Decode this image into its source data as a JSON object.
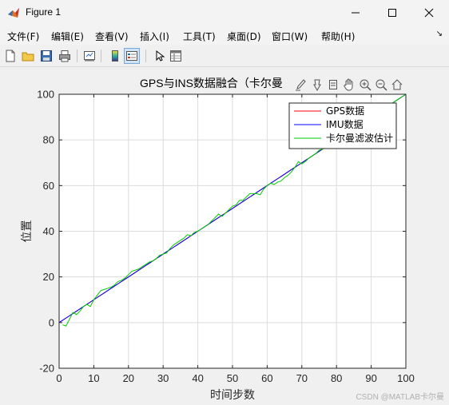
{
  "window": {
    "title": "Figure 1"
  },
  "menu": [
    {
      "label": "文件(F)"
    },
    {
      "label": "编辑(E)"
    },
    {
      "label": "查看(V)"
    },
    {
      "label": "插入(I)"
    },
    {
      "label": "工具(T)"
    },
    {
      "label": "桌面(D)"
    },
    {
      "label": "窗口(W)"
    },
    {
      "label": "帮助(H)"
    }
  ],
  "toolbar_icons": [
    "new-figure-icon",
    "open-file-icon",
    "save-icon",
    "print-icon",
    "link-plot-icon",
    "insert-colorbar-icon",
    "insert-legend-icon",
    "edit-plot-icon",
    "property-inspector-icon"
  ],
  "axes_toolbar_icons": [
    "brush-icon",
    "data-tips-icon",
    "rotate-icon",
    "pan-icon",
    "zoom-in-icon",
    "zoom-out-icon",
    "home-icon"
  ],
  "watermark": "CSDN @MATLAB卡尔曼",
  "chart_data": {
    "type": "line",
    "title": "GPS与INS数据融合（卡尔曼",
    "xlabel": "时间步数",
    "ylabel": "位置",
    "xlim": [
      0,
      100
    ],
    "ylim": [
      -20,
      100
    ],
    "xticks": [
      0,
      10,
      20,
      30,
      40,
      50,
      60,
      70,
      80,
      90,
      100
    ],
    "yticks": [
      -20,
      0,
      20,
      40,
      60,
      80,
      100
    ],
    "grid": true,
    "legend_position": "top-right",
    "series": [
      {
        "name": "GPS数据",
        "color": "#ff0000",
        "x": [
          0,
          1,
          2,
          3,
          4,
          5,
          6,
          7,
          8,
          9,
          10,
          11,
          12,
          13,
          14,
          15,
          16,
          17,
          18,
          19,
          20,
          21,
          22,
          23,
          24,
          25,
          26,
          27,
          28,
          29,
          30,
          31,
          32,
          33,
          34,
          35,
          36,
          37,
          38,
          39,
          40,
          41,
          42,
          43,
          44,
          45,
          46,
          47,
          48,
          49,
          50,
          51,
          52,
          53,
          54,
          55,
          56,
          57,
          58,
          59,
          60,
          61,
          62,
          63,
          64,
          65,
          66,
          67,
          68,
          69,
          70,
          71,
          72,
          73,
          74,
          75,
          76,
          77,
          78,
          79,
          80,
          81,
          82,
          83,
          84,
          85,
          86,
          87,
          88,
          89,
          90,
          91,
          92,
          93,
          94,
          95,
          96,
          97,
          98,
          99,
          100
        ],
        "y": [
          0,
          1,
          2,
          3,
          4,
          5,
          6,
          7,
          8,
          9,
          10,
          11,
          12,
          13,
          14,
          15,
          16,
          17,
          18,
          19,
          20,
          21,
          22,
          23,
          24,
          25,
          26,
          27,
          28,
          29,
          30,
          31,
          32,
          33,
          34,
          35,
          36,
          37,
          38,
          39,
          40,
          41,
          42,
          43,
          44,
          45,
          46,
          47,
          48,
          49,
          50,
          51,
          52,
          53,
          54,
          55,
          56,
          57,
          58,
          59,
          60,
          61,
          62,
          63,
          64,
          65,
          66,
          67,
          68,
          69,
          70,
          71,
          72,
          73,
          74,
          75,
          76,
          77,
          78,
          79,
          80,
          81,
          82,
          83,
          84,
          85,
          86,
          87,
          88,
          89,
          90,
          91,
          92,
          93,
          94,
          95,
          96,
          97,
          98,
          99,
          100
        ]
      },
      {
        "name": "IMU数据",
        "color": "#0000ff",
        "x": [
          0,
          1,
          2,
          3,
          4,
          5,
          6,
          7,
          8,
          9,
          10,
          11,
          12,
          13,
          14,
          15,
          16,
          17,
          18,
          19,
          20,
          21,
          22,
          23,
          24,
          25,
          26,
          27,
          28,
          29,
          30,
          31,
          32,
          33,
          34,
          35,
          36,
          37,
          38,
          39,
          40,
          41,
          42,
          43,
          44,
          45,
          46,
          47,
          48,
          49,
          50,
          51,
          52,
          53,
          54,
          55,
          56,
          57,
          58,
          59,
          60,
          61,
          62,
          63,
          64,
          65,
          66,
          67,
          68,
          69,
          70,
          71,
          72,
          73,
          74,
          75,
          76,
          77,
          78,
          79,
          80,
          81,
          82,
          83,
          84,
          85,
          86,
          87,
          88,
          89,
          90,
          91,
          92,
          93,
          94,
          95,
          96,
          97,
          98,
          99,
          100
        ],
        "y": [
          0,
          1,
          2,
          3,
          4,
          5,
          6,
          7,
          8,
          9,
          10,
          11,
          12,
          13,
          14,
          15,
          16,
          17,
          18,
          19,
          20,
          21,
          22,
          23,
          24,
          25,
          26,
          27,
          28,
          29,
          30,
          31,
          32,
          33,
          34,
          35,
          36,
          37,
          38,
          39,
          40,
          41,
          42,
          43,
          44,
          45,
          46,
          47,
          48,
          49,
          50,
          51,
          52,
          53,
          54,
          55,
          56,
          57,
          58,
          59,
          60,
          61,
          62,
          63,
          64,
          65,
          66,
          67,
          68,
          69,
          70,
          71,
          72,
          73,
          74,
          75,
          76,
          77,
          78,
          79,
          80,
          81,
          82,
          83,
          84,
          85,
          86,
          87,
          88,
          89,
          90,
          91,
          92,
          93,
          94,
          95,
          96,
          97,
          98,
          99,
          100
        ]
      },
      {
        "name": "卡尔曼滤波估计",
        "color": "#00cc00",
        "x": [
          1,
          2,
          3,
          4,
          5,
          6,
          7,
          8,
          9,
          10,
          11,
          12,
          13,
          14,
          15,
          16,
          17,
          18,
          19,
          20,
          21,
          22,
          23,
          24,
          25,
          26,
          27,
          28,
          29,
          30,
          31,
          32,
          33,
          34,
          35,
          36,
          37,
          38,
          39,
          40,
          41,
          42,
          43,
          44,
          45,
          46,
          47,
          48,
          49,
          50,
          51,
          52,
          53,
          54,
          55,
          56,
          57,
          58,
          59,
          60,
          61,
          62,
          63,
          64,
          65,
          66,
          67,
          68,
          69,
          70,
          71,
          72,
          73,
          74,
          75,
          76,
          77,
          78,
          79,
          80,
          81,
          82,
          83,
          84,
          85,
          86,
          87,
          88,
          89,
          90,
          91,
          92,
          93,
          94,
          95,
          96,
          97,
          98,
          99,
          100
        ],
        "y": [
          -1,
          -1.5,
          1.5,
          4.5,
          3.5,
          5,
          7,
          8,
          7,
          10,
          12,
          14,
          14.5,
          15,
          15.5,
          16.5,
          18,
          18.5,
          19.5,
          21,
          22.5,
          23,
          23.5,
          24.5,
          25.5,
          26.5,
          27,
          28,
          29.5,
          30,
          30.5,
          32.5,
          34,
          35,
          36,
          37,
          38.5,
          38,
          39.5,
          40,
          41,
          42,
          43,
          44.5,
          46,
          47.5,
          46.5,
          48,
          49.5,
          51,
          51.5,
          53.5,
          53.5,
          55,
          56.5,
          56.5,
          56.5,
          56,
          58.5,
          60,
          61,
          60.5,
          61.5,
          62,
          63.5,
          64.5,
          66,
          68,
          70.5,
          69.5,
          70.5,
          72,
          73,
          74,
          75.5,
          76,
          77,
          78,
          79,
          80,
          81,
          82,
          83,
          84,
          85,
          86,
          87,
          88,
          89,
          90,
          91,
          92,
          93,
          94,
          95,
          96,
          97,
          98,
          99,
          100
        ]
      }
    ]
  }
}
